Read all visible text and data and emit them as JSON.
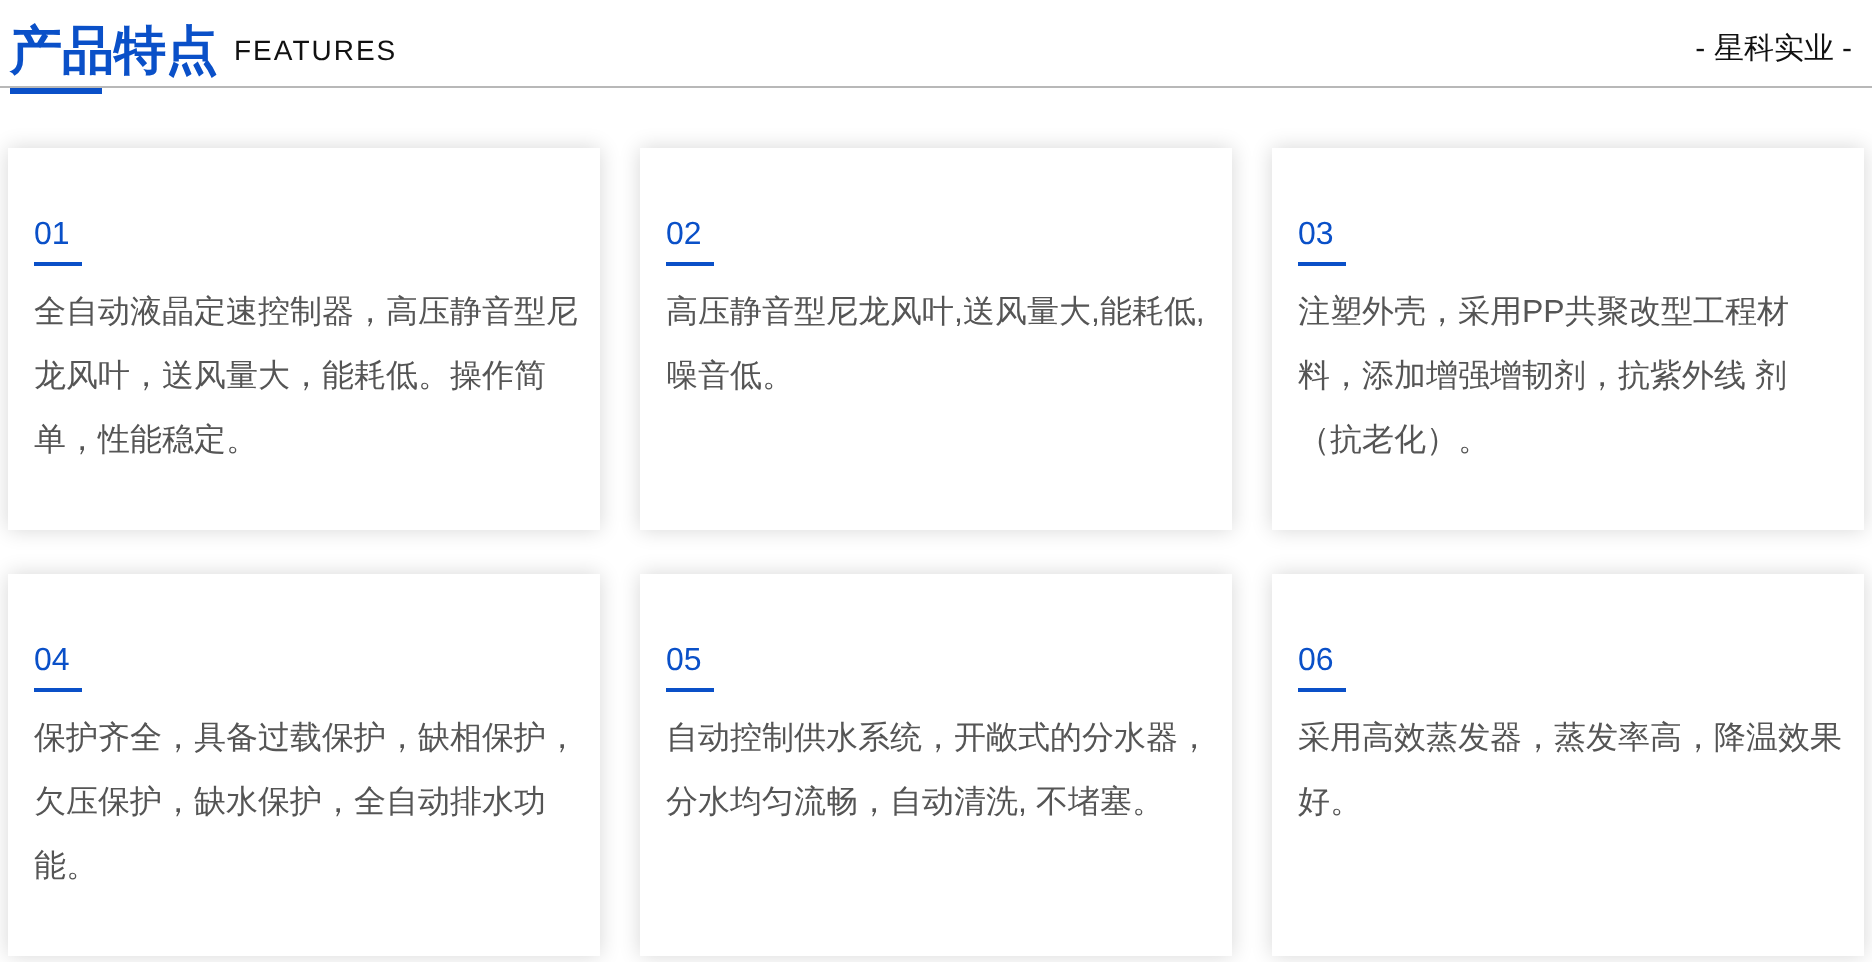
{
  "header": {
    "title": "产品特点",
    "subtitle": "FEATURES",
    "brand": "- 星科实业 -"
  },
  "features": [
    {
      "number": "01",
      "text": "全自动液晶定速控制器，高压静音型尼龙风叶，送风量大，能耗低。操作简单，性能稳定。"
    },
    {
      "number": "02",
      "text": "高压静音型尼龙风叶,送风量大,能耗低,噪音低。"
    },
    {
      "number": "03",
      "text": "注塑外壳，采用PP共聚改型工程材料，添加增强增韧剂，抗紫外线 剂（抗老化）。"
    },
    {
      "number": "04",
      "text": "保护齐全，具备过载保护，缺相保护，欠压保护，缺水保护，全自动排水功能。"
    },
    {
      "number": "05",
      "text": "自动控制供水系统，开敞式的分水器，分水均匀流畅，自动清洗, 不堵塞。"
    },
    {
      "number": "06",
      "text": "采用高效蒸发器，蒸发率高，降温效果好。"
    }
  ]
}
